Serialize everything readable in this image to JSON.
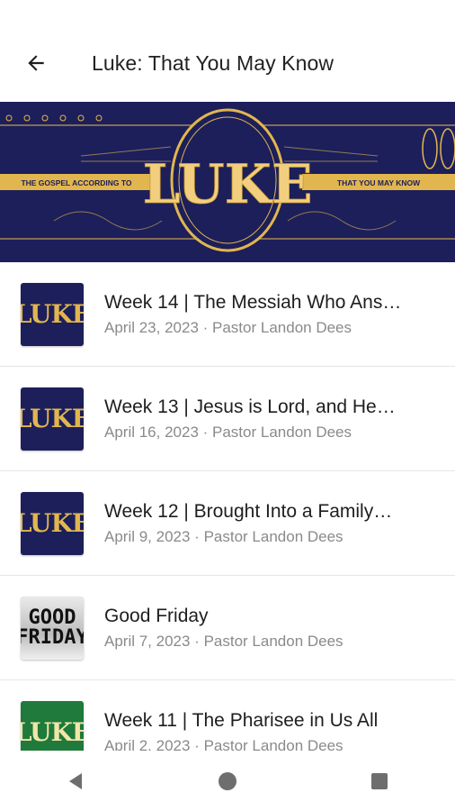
{
  "appbar": {
    "title": "Luke: That You May Know"
  },
  "banner": {
    "main_word": "LUKE",
    "left_ribbon": "THE GOSPEL ACCORDING TO",
    "right_ribbon": "THAT YOU MAY KNOW",
    "colors": {
      "bg": "#1c1f5a",
      "gold": "#e2b64f"
    }
  },
  "sermons": [
    {
      "title": "Week 14 | The Messiah Who Ans…",
      "date": "April 23, 2023",
      "pastor": "Pastor Landon Dees",
      "thumb": "LUKE",
      "style": "luke-navy"
    },
    {
      "title": "Week 13 | Jesus is Lord, and He…",
      "date": "April 16, 2023",
      "pastor": "Pastor Landon Dees",
      "thumb": "LUKE",
      "style": "luke-navy"
    },
    {
      "title": "Week 12 | Brought Into a Family…",
      "date": "April 9, 2023",
      "pastor": "Pastor Landon Dees",
      "thumb": "LUKE",
      "style": "luke-navy"
    },
    {
      "title": "Good Friday",
      "date": "April 7, 2023",
      "pastor": "Pastor Landon Dees",
      "thumb_line1": "GOOD",
      "thumb_line2": "FRIDAY",
      "style": "goodfriday"
    },
    {
      "title": "Week 11 | The Pharisee in Us All",
      "date": "April 2, 2023",
      "pastor": "Pastor Landon Dees",
      "thumb": "LUKE",
      "style": "luke-green"
    }
  ],
  "separator": " · ",
  "icons": {
    "back": "arrow-left-icon",
    "nav_back": "triangle-back-icon",
    "nav_home": "circle-home-icon",
    "nav_recents": "square-recents-icon"
  }
}
